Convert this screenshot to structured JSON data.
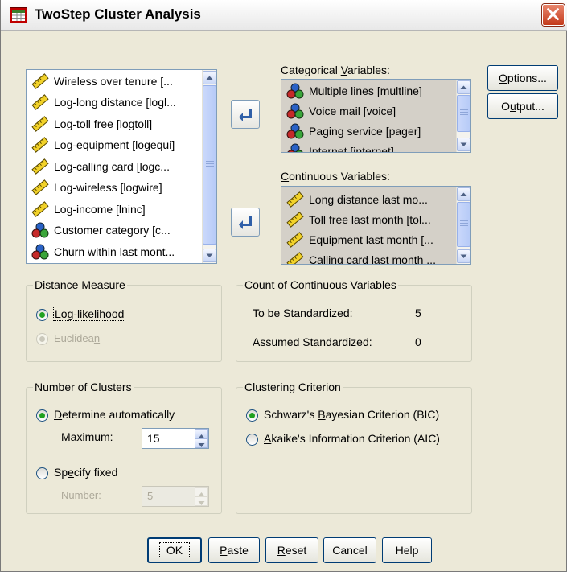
{
  "window": {
    "title": "TwoStep Cluster Analysis"
  },
  "source_list": {
    "items": [
      {
        "label": "Wireless over tenure [...",
        "icon": "scale-ruler-icon"
      },
      {
        "label": "Log-long distance [logl...",
        "icon": "scale-ruler-icon"
      },
      {
        "label": "Log-toll free [logtoll]",
        "icon": "scale-ruler-icon"
      },
      {
        "label": "Log-equipment [logequi]",
        "icon": "scale-ruler-icon"
      },
      {
        "label": "Log-calling card [logc...",
        "icon": "scale-ruler-icon"
      },
      {
        "label": "Log-wireless [logwire]",
        "icon": "scale-ruler-icon"
      },
      {
        "label": "Log-income [lninc]",
        "icon": "scale-ruler-icon"
      },
      {
        "label": "Customer category [c...",
        "icon": "nominal-balls-icon"
      },
      {
        "label": "Churn within last mont...",
        "icon": "nominal-balls-icon"
      }
    ]
  },
  "categorical": {
    "label_pre": "Categorical ",
    "label_u": "V",
    "label_post": "ariables:",
    "items": [
      {
        "label": "Multiple lines [multline]"
      },
      {
        "label": "Voice mail [voice]"
      },
      {
        "label": "Paging service [pager]"
      },
      {
        "label": "Internet [internet]"
      }
    ]
  },
  "continuous": {
    "label_pre": "",
    "label_u": "C",
    "label_post": "ontinuous Variables:",
    "items": [
      {
        "label": "Long distance last mo..."
      },
      {
        "label": "Toll free last month [tol..."
      },
      {
        "label": "Equipment last month [..."
      },
      {
        "label": "Calling card last month ..."
      }
    ]
  },
  "buttons": {
    "options_u": "O",
    "options_rest": "ptions...",
    "output_pre": "O",
    "output_u": "u",
    "output_rest": "tput...",
    "ok": "OK",
    "paste_u": "P",
    "paste_rest": "aste",
    "reset_u": "R",
    "reset_rest": "eset",
    "cancel": "Cancel",
    "help": "Help"
  },
  "distance_measure": {
    "title": "Distance Measure",
    "loglik_u": "L",
    "loglik_rest": "og-likelihood",
    "euclid_pre": "Euclidea",
    "euclid_u": "n"
  },
  "count_continuous": {
    "title": "Count of Continuous Variables",
    "to_be_label": "To be Standardized:",
    "to_be_value": "5",
    "assumed_label": "Assumed Standardized:",
    "assumed_value": "0"
  },
  "number_of_clusters": {
    "title": "Number of Clusters",
    "auto_u": "D",
    "auto_rest": "etermine automatically",
    "max_pre": "Ma",
    "max_u": "x",
    "max_rest": "imum:",
    "max_value": "15",
    "fixed_pre": "Sp",
    "fixed_u": "e",
    "fixed_rest": "cify fixed",
    "number_pre": "Num",
    "number_u": "b",
    "number_rest": "er:",
    "number_value": "5"
  },
  "clustering_criterion": {
    "title": "Clustering Criterion",
    "bic_pre": "Schwarz's ",
    "bic_u": "B",
    "bic_rest": "ayesian Criterion (BIC)",
    "aic_u": "A",
    "aic_rest": "kaike's Information Criterion (AIC)"
  }
}
